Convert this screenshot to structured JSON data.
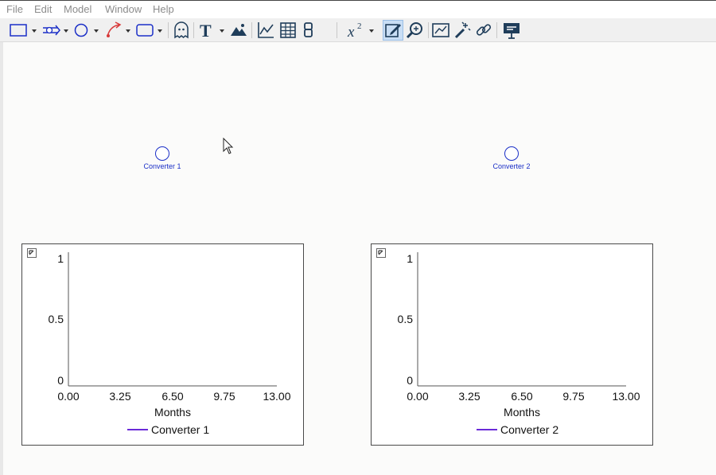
{
  "menu": {
    "file": "File",
    "edit": "Edit",
    "model": "Model",
    "window": "Window",
    "help": "Help"
  },
  "toolbar": {
    "tools": [
      "stock-tool",
      "flow-tool",
      "converter-tool",
      "connector-tool",
      "module-tool",
      "ghost-tool",
      "text-tool",
      "image-tool",
      "graph-tool",
      "table-tool",
      "numeric-display-tool",
      "equation-tool",
      "edit-mode-tool",
      "zoom-tool",
      "graph-pad-tool",
      "magic-wand-tool",
      "link-tool",
      "presentation-tool"
    ],
    "active_tool": "edit-mode-tool",
    "icon_color": "#1f3d5a",
    "accent_color": "#1b2fc7"
  },
  "canvas": {
    "converters": [
      {
        "label": "Converter 1"
      },
      {
        "label": "Converter 2"
      }
    ]
  },
  "graphs": [
    {
      "legend": "Converter 1"
    },
    {
      "legend": "Converter 2"
    }
  ],
  "chart_data": [
    {
      "type": "line",
      "xlabel": "Months",
      "ylabel": "",
      "x_ticks": [
        "0.00",
        "3.25",
        "6.50",
        "9.75",
        "13.00"
      ],
      "y_ticks": [
        "0",
        "0.5",
        "1"
      ],
      "xlim": [
        0,
        13
      ],
      "ylim": [
        0,
        1
      ],
      "series": [
        {
          "name": "Converter 1",
          "color": "#6a2bd8",
          "values": []
        }
      ],
      "legend_position": "bottom"
    },
    {
      "type": "line",
      "xlabel": "Months",
      "ylabel": "",
      "x_ticks": [
        "0.00",
        "3.25",
        "6.50",
        "9.75",
        "13.00"
      ],
      "y_ticks": [
        "0",
        "0.5",
        "1"
      ],
      "xlim": [
        0,
        13
      ],
      "ylim": [
        0,
        1
      ],
      "series": [
        {
          "name": "Converter 2",
          "color": "#6a2bd8",
          "values": []
        }
      ],
      "legend_position": "bottom"
    }
  ]
}
